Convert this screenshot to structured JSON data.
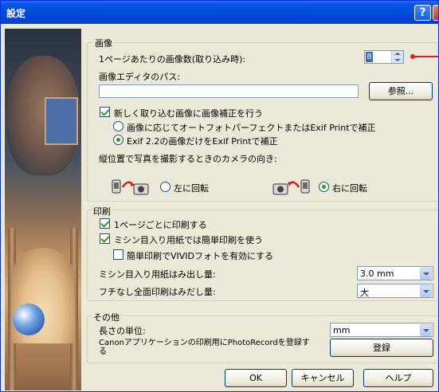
{
  "window": {
    "title": "設定",
    "help_glyph": "?"
  },
  "image_group": {
    "legend": "画像",
    "per_page_label": "1ページあたりの画像数(取り込み時):",
    "per_page_value": "8",
    "editor_path_label": "画像エディタのパス:",
    "editor_path_value": "",
    "browse_label": "参照...",
    "auto_correct": {
      "label": "新しく取り込む画像に画像補正を行う",
      "checked": true
    },
    "radio_photo_perfect": {
      "label": "画像に応じてオートフォトパーフェクトまたはExif Printで補正",
      "checked": false
    },
    "radio_exif22": {
      "label": "Exif 2.2の画像だけをExif Printで補正",
      "checked": true
    },
    "orientation_label": "縦位置で写真を撮影するときのカメラの向き:",
    "rotate_left": {
      "label": "左に回転",
      "checked": false
    },
    "rotate_right": {
      "label": "右に回転",
      "checked": true
    }
  },
  "print_group": {
    "legend": "印刷",
    "per_page_print": {
      "label": "1ページごとに印刷する",
      "checked": true
    },
    "perforated_simple": {
      "label": "ミシン目入り用紙では簡単印刷を使う",
      "checked": true
    },
    "vivid_photo": {
      "label": "簡単印刷でVIVIDフォトを有効にする",
      "checked": false
    },
    "perforated_overflow_label": "ミシン目入り用紙はみ出し量:",
    "perforated_overflow_value": "3.0 mm",
    "borderless_overflow_label": "フチなし全面印刷はみだし量:",
    "borderless_overflow_value": "大"
  },
  "other_group": {
    "legend": "その他",
    "length_unit_label": "長さの単位:",
    "length_unit_value": "mm",
    "register_text": "Canonアプリケーションの印刷用にPhotoRecordを登録する",
    "register_label": "登録"
  },
  "footer": {
    "ok_label": "OK",
    "cancel_label": "キャンセル",
    "help_label": "ヘルプ"
  },
  "colors": {
    "title_bar": "#0050e0",
    "dialog_bg": "#ece9d8",
    "check_mark": "#21a121",
    "annotation_line": "#e21c1c"
  }
}
